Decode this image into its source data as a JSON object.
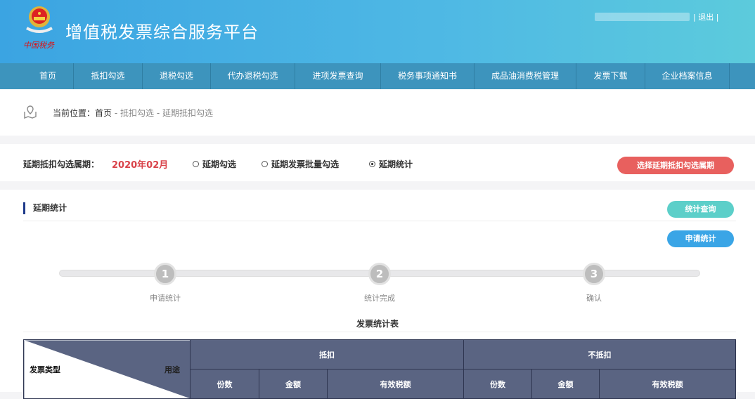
{
  "header": {
    "title": "增值税发票综合服务平台",
    "logo_text": "中国税务",
    "logout": "退出"
  },
  "nav": [
    "首页",
    "抵扣勾选",
    "退税勾选",
    "代办退税勾选",
    "进项发票查询",
    "税务事项通知书",
    "成品油消费税管理",
    "发票下载",
    "企业档案信息"
  ],
  "breadcrumb": {
    "label": "当前位置：",
    "home": "首页",
    "sep1": " - ",
    "level2": "抵扣勾选",
    "sep2": " - ",
    "level3": "延期抵扣勾选"
  },
  "period": {
    "label": "延期抵扣勾选属期：",
    "value": "2020年02月",
    "options": [
      "延期勾选",
      "延期发票批量勾选",
      "延期统计"
    ],
    "selected": "延期统计",
    "select_button": "选择延期抵扣勾选属期"
  },
  "section": {
    "title": "延期统计",
    "query_button": "统计查询",
    "apply_button": "申请统计"
  },
  "steps": [
    {
      "num": "1",
      "label": "申请统计"
    },
    {
      "num": "2",
      "label": "统计完成"
    },
    {
      "num": "3",
      "label": "确认"
    }
  ],
  "table": {
    "title": "发票统计表",
    "corner_left": "发票类型",
    "corner_right": "用途",
    "groups": [
      "抵扣",
      "不抵扣"
    ],
    "columns": [
      "份数",
      "金额",
      "有效税额",
      "份数",
      "金额",
      "有效税额"
    ]
  },
  "colors": {
    "accent_red": "#e8605e",
    "teal": "#5ccfc9",
    "blue": "#3aa5e6",
    "table_header": "#5a6482"
  }
}
